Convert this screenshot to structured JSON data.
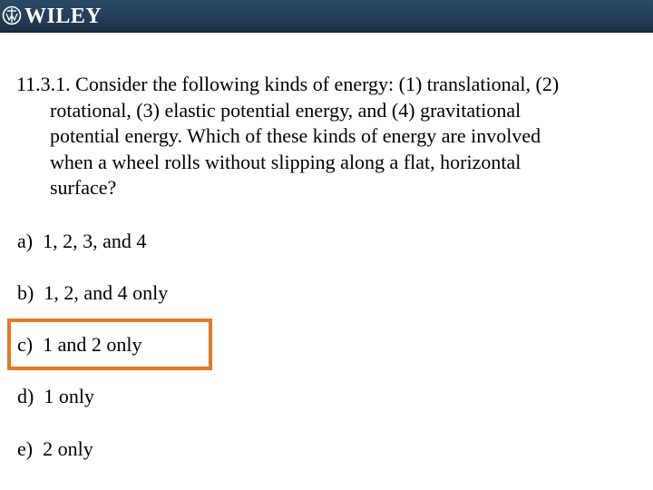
{
  "header": {
    "logo_text": "WILEY",
    "logo_icon": "wiley-emblem-icon",
    "colors": {
      "bar_top": "#2c4a66",
      "bar_bottom": "#1c2e42",
      "logo_text": "#ffffff"
    }
  },
  "question": {
    "number": "11.3.1.",
    "first_line": "11.3.1. Consider the following kinds of energy: (1) translational, (2)",
    "continuation_lines": [
      "rotational, (3) elastic potential energy, and (4) gravitational",
      "potential energy.  Which of these kinds of energy are involved",
      "when a wheel rolls without slipping along a flat, horizontal",
      "surface?"
    ]
  },
  "options": [
    {
      "letter": "a)",
      "text": "a)  1, 2, 3, and 4"
    },
    {
      "letter": "b)",
      "text": "b)  1, 2, and 4 only"
    },
    {
      "letter": "c)",
      "text": "c)  1 and 2 only",
      "highlighted": true
    },
    {
      "letter": "d)",
      "text": "d)  1 only"
    },
    {
      "letter": "e)",
      "text": "e)  2 only"
    }
  ],
  "highlight": {
    "option": "c)",
    "color": "#e87722"
  }
}
